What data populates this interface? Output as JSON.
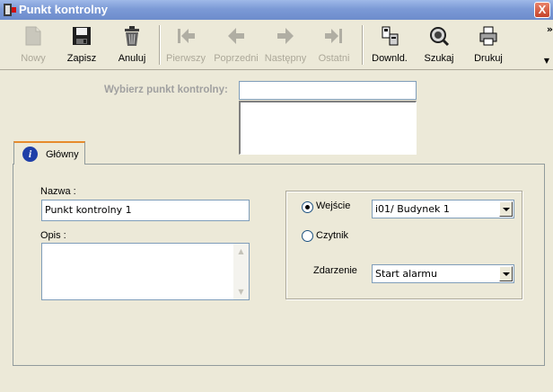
{
  "window": {
    "title": "Punkt kontrolny",
    "close_label": "X"
  },
  "toolbar": {
    "buttons": [
      {
        "label": "Nowy",
        "icon": "new-document-icon",
        "enabled": false
      },
      {
        "label": "Zapisz",
        "icon": "floppy-disk-icon",
        "enabled": true
      },
      {
        "label": "Anuluj",
        "icon": "trash-icon",
        "enabled": true
      },
      {
        "label": "Pierwszy",
        "icon": "first-arrow-icon",
        "enabled": false
      },
      {
        "label": "Poprzedni",
        "icon": "previous-arrow-icon",
        "enabled": false
      },
      {
        "label": "Następny",
        "icon": "next-arrow-icon",
        "enabled": false
      },
      {
        "label": "Ostatni",
        "icon": "last-arrow-icon",
        "enabled": false
      },
      {
        "label": "Downld.",
        "icon": "download-icon",
        "enabled": true
      },
      {
        "label": "Szukaj",
        "icon": "search-icon",
        "enabled": true
      },
      {
        "label": "Drukuj",
        "icon": "printer-icon",
        "enabled": true
      }
    ],
    "overflow_label": "»",
    "more_arrow": "▼"
  },
  "selector": {
    "label": "Wybierz punkt kontrolny:",
    "value": ""
  },
  "tabs": [
    {
      "label": "Główny",
      "active": true
    }
  ],
  "form": {
    "nazwa_label": "Nazwa :",
    "nazwa_value": "Punkt kontrolny 1",
    "opis_label": "Opis :",
    "opis_value": "",
    "source_options": [
      {
        "label": "Wejście",
        "checked": true
      },
      {
        "label": "Czytnik",
        "checked": false
      }
    ],
    "wejscie_value": "i01/ Budynek 1",
    "zdarzenie_label": "Zdarzenie",
    "zdarzenie_value": "Start alarmu"
  },
  "colors": {
    "accent_tab": "#e68b2c",
    "titlebar": "#7c9ad6",
    "disabled_text": "#aca899"
  }
}
